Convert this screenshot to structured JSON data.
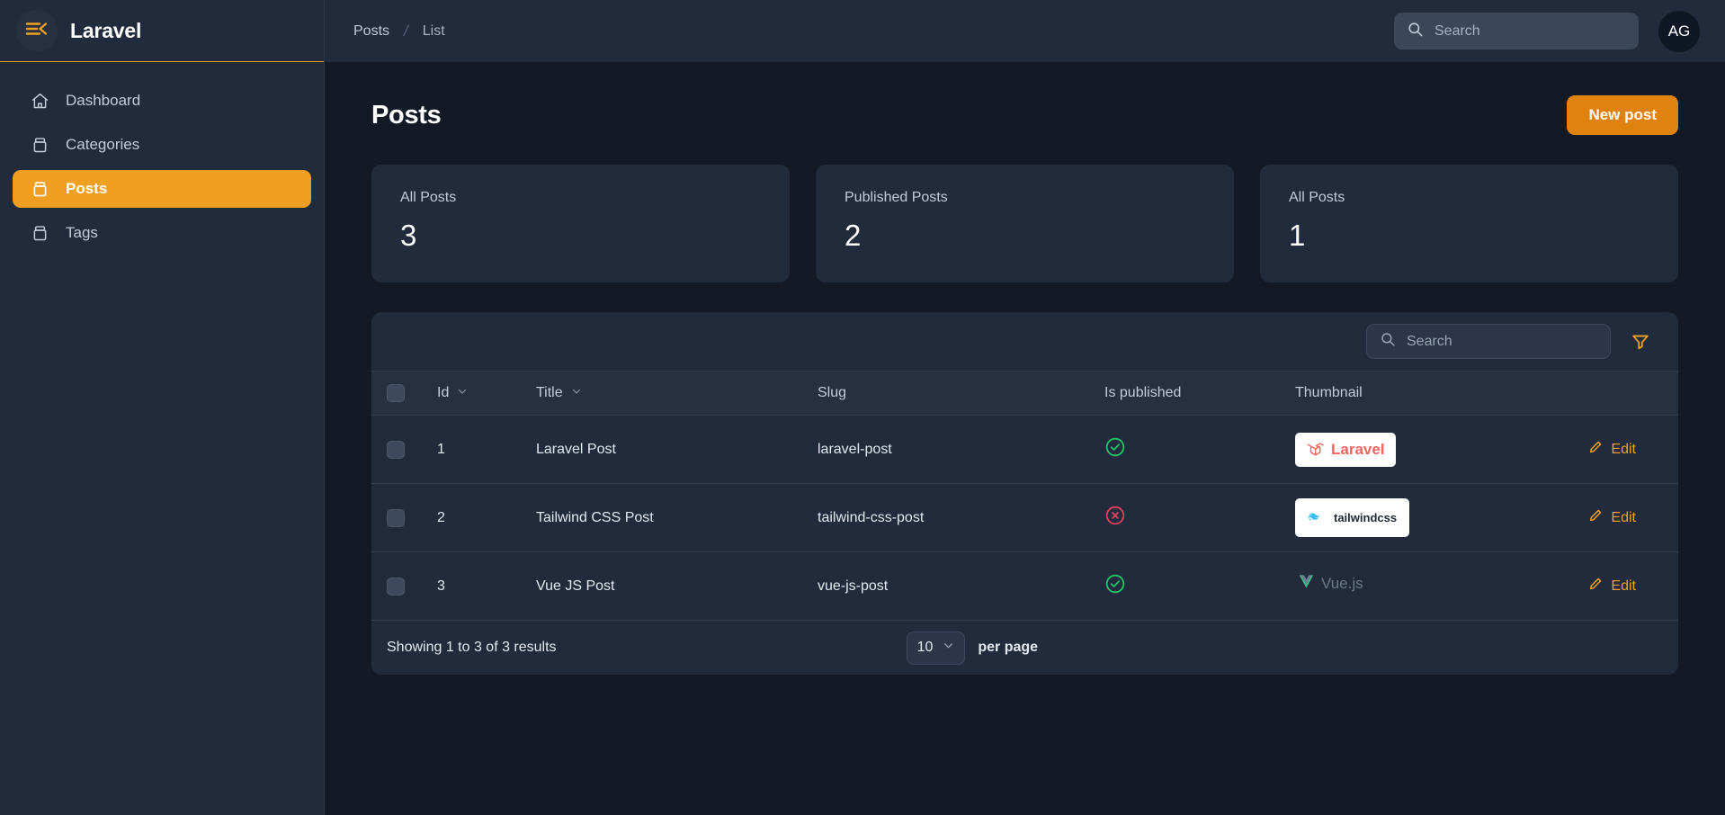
{
  "brand": {
    "name": "Laravel",
    "menu_icon": "hamburger-collapse-icon"
  },
  "sidebar": {
    "items": [
      {
        "label": "Dashboard",
        "icon": "home-icon",
        "active": false
      },
      {
        "label": "Categories",
        "icon": "archive-box-icon",
        "active": false
      },
      {
        "label": "Posts",
        "icon": "archive-box-icon",
        "active": true
      },
      {
        "label": "Tags",
        "icon": "archive-box-icon",
        "active": false
      }
    ]
  },
  "topbar": {
    "breadcrumb": [
      "Posts",
      "List"
    ],
    "breadcrumb_separator": "/",
    "search": {
      "value": "",
      "placeholder": "Search",
      "icon": "search-icon"
    },
    "avatar": {
      "initials": "AG"
    }
  },
  "page": {
    "title": "Posts",
    "new_button": "New post"
  },
  "stats": [
    {
      "label": "All Posts",
      "value": "3"
    },
    {
      "label": "Published Posts",
      "value": "2"
    },
    {
      "label": "All Posts",
      "value": "1"
    }
  ],
  "table": {
    "search": {
      "value": "",
      "placeholder": "Search",
      "icon": "search-icon"
    },
    "filter_icon": "filter-funnel-icon",
    "columns": [
      {
        "key": "checkbox",
        "label": "",
        "sortable": false
      },
      {
        "key": "id",
        "label": "Id",
        "sortable": true
      },
      {
        "key": "title",
        "label": "Title",
        "sortable": true
      },
      {
        "key": "slug",
        "label": "Slug",
        "sortable": false
      },
      {
        "key": "is_published",
        "label": "Is published",
        "sortable": false
      },
      {
        "key": "thumbnail",
        "label": "Thumbnail",
        "sortable": false
      },
      {
        "key": "actions",
        "label": "",
        "sortable": false
      }
    ],
    "rows": [
      {
        "id": "1",
        "title": "Laravel Post",
        "slug": "laravel-post",
        "is_published": true,
        "published_icon": "check-circle-icon",
        "thumbnail": {
          "name": "laravel-logo",
          "text": "Laravel",
          "style": "white-card"
        },
        "action": "Edit",
        "action_icon": "pencil-icon"
      },
      {
        "id": "2",
        "title": "Tailwind CSS Post",
        "slug": "tailwind-css-post",
        "is_published": false,
        "published_icon": "x-circle-icon",
        "thumbnail": {
          "name": "tailwindcss-logo",
          "text": "tailwindcss",
          "style": "white-card"
        },
        "action": "Edit",
        "action_icon": "pencil-icon"
      },
      {
        "id": "3",
        "title": "Vue JS Post",
        "slug": "vue-js-post",
        "is_published": true,
        "published_icon": "check-circle-icon",
        "thumbnail": {
          "name": "vuejs-logo",
          "text": "Vue.js",
          "style": "transparent"
        },
        "action": "Edit",
        "action_icon": "pencil-icon"
      }
    ],
    "footer": {
      "results_text": "Showing 1 to 3 of 3 results",
      "per_page_value": "10",
      "per_page_label": "per page"
    }
  },
  "colors": {
    "accent": "#f0a020",
    "accent_button": "#e0820e",
    "page_bg": "#131a26",
    "panel_bg": "#212b3b",
    "success": "#1cc56a",
    "danger": "#e5405e",
    "laravel_red": "#f4645f",
    "tailwind_teal": "#38bdf8",
    "vue_green": "#41b883"
  }
}
